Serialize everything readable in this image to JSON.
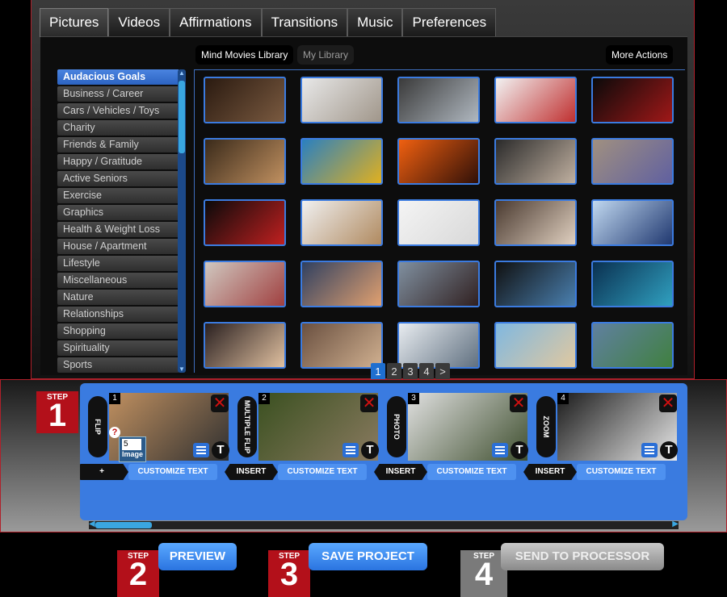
{
  "tabs": [
    "Pictures",
    "Videos",
    "Affirmations",
    "Transitions",
    "Music",
    "Preferences"
  ],
  "library": {
    "mind_movies_library": "Mind Movies Library",
    "my_library": "My Library",
    "more_actions": "More Actions"
  },
  "categories": [
    "Audacious Goals",
    "Business / Career",
    "Cars / Vehicles / Toys",
    "Charity",
    "Friends & Family",
    "Happy / Gratitude",
    "Active Seniors",
    "Exercise",
    "Graphics",
    "Health & Weight Loss",
    "House / Apartment",
    "Lifestyle",
    "Miscellaneous",
    "Nature",
    "Relationships",
    "Shopping",
    "Spirituality",
    "Sports"
  ],
  "thumbnails": [
    {
      "name": "singer-microphone-studio",
      "c1": "#2a1a10",
      "c2": "#7a5a40"
    },
    {
      "name": "ballet-dancer-studio",
      "c1": "#e8e8e8",
      "c2": "#a0968a"
    },
    {
      "name": "boy-drummer",
      "c1": "#3a3a3a",
      "c2": "#b0b8c0"
    },
    {
      "name": "guitarist-red-shirt",
      "c1": "#f2f2f2",
      "c2": "#c03030"
    },
    {
      "name": "rock-guitarist-dark",
      "c1": "#0a0a0a",
      "c2": "#a01818"
    },
    {
      "name": "horse-rider-beach",
      "c1": "#3a2a1a",
      "c2": "#c09060"
    },
    {
      "name": "kayak-couple",
      "c1": "#2a80c0",
      "c2": "#e0b020"
    },
    {
      "name": "horse-sunset",
      "c1": "#f06010",
      "c2": "#301008"
    },
    {
      "name": "woman-guitar-couch",
      "c1": "#2a2a2a",
      "c2": "#c0b0a0"
    },
    {
      "name": "rock-climber",
      "c1": "#a09080",
      "c2": "#6060a0"
    },
    {
      "name": "singer-red-dress",
      "c1": "#0a0a0a",
      "c2": "#c02020"
    },
    {
      "name": "yoga-beach",
      "c1": "#f0f0f0",
      "c2": "#b08a60"
    },
    {
      "name": "ballerina-tutu",
      "c1": "#f4f4f4",
      "c2": "#d8d8d8"
    },
    {
      "name": "women-office-desk",
      "c1": "#4a3a30",
      "c2": "#e0d0c0"
    },
    {
      "name": "couple-snow",
      "c1": "#c0d8f0",
      "c2": "#203870"
    },
    {
      "name": "woman-painting-wall",
      "c1": "#d0c8c0",
      "c2": "#a04040"
    },
    {
      "name": "painter-easel-sunset",
      "c1": "#304060",
      "c2": "#e0a070"
    },
    {
      "name": "couple-car-sunglasses",
      "c1": "#8090a0",
      "c2": "#302020"
    },
    {
      "name": "camera-lens",
      "c1": "#101010",
      "c2": "#4a80b0"
    },
    {
      "name": "diver-underwater",
      "c1": "#0a3050",
      "c2": "#30a0c0"
    },
    {
      "name": "makeup-artist",
      "c1": "#2a2020",
      "c2": "#e0c0a0"
    },
    {
      "name": "couple-with-baby",
      "c1": "#6a5040",
      "c2": "#d0b090"
    },
    {
      "name": "man-computer-office",
      "c1": "#e8ecf0",
      "c2": "#607080"
    },
    {
      "name": "woman-bikini-beach",
      "c1": "#80b8e0",
      "c2": "#e0c8a0"
    },
    {
      "name": "runners-mountain",
      "c1": "#6080a0",
      "c2": "#408040"
    }
  ],
  "pages": [
    "1",
    "2",
    "3",
    "4",
    ">"
  ],
  "step1": {
    "label": "STEP",
    "number": "1"
  },
  "slides": [
    {
      "num": "1",
      "transition": "FLIP",
      "left_btn": "+",
      "customize": "CUSTOMIZE TEXT",
      "c1": "#c09060",
      "c2": "#303030",
      "badge_value": "5",
      "badge_label": "Image",
      "help": "?"
    },
    {
      "num": "2",
      "transition": "MULTIPLE FLIP",
      "left_btn": "INSERT",
      "customize": "CUSTOMIZE TEXT",
      "c1": "#3a5020",
      "c2": "#8a7a60"
    },
    {
      "num": "3",
      "transition": "PHOTO",
      "left_btn": "INSERT",
      "customize": "CUSTOMIZE TEXT",
      "c1": "#e0e0e0",
      "c2": "#405030"
    },
    {
      "num": "4",
      "transition": "ZOOM",
      "left_btn": "INSERT",
      "customize": "CUSTOMIZE TEXT",
      "c1": "#1a1a1a",
      "c2": "#e8e8e8"
    }
  ],
  "steps": [
    {
      "label": "STEP",
      "number": "2",
      "action": "PREVIEW"
    },
    {
      "label": "STEP",
      "number": "3",
      "action": "SAVE PROJECT"
    },
    {
      "label": "STEP",
      "number": "4",
      "action": "SEND TO PROCESSOR"
    }
  ],
  "colors": {
    "accent_blue": "#3a7be0",
    "step_red": "#b3101a",
    "step_gray": "#8a8a8a"
  }
}
